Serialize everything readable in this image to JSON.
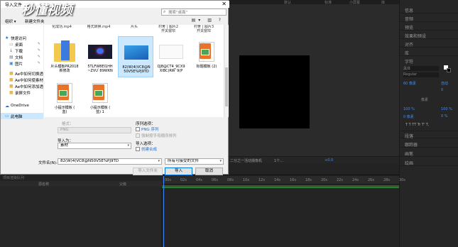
{
  "watermark": "秒懂视频",
  "dialog": {
    "title": "导入文件",
    "search_placeholder": "搜索\"桌面\"",
    "toolbar": {
      "organize": "组织 ▾",
      "new_folder": "新建文件夹"
    },
    "nav": [
      {
        "icon": "star-icon",
        "label": "快速访问",
        "pinned": false
      },
      {
        "icon": "desktop-folder-icon",
        "label": "桌面",
        "pinned": true
      },
      {
        "icon": "download-folder-icon",
        "label": "下载",
        "pinned": true
      },
      {
        "icon": "documents-folder-icon",
        "label": "文档",
        "pinned": true
      },
      {
        "icon": "pictures-folder-icon",
        "label": "图片",
        "pinned": true
      },
      {
        "icon": "folder-icon",
        "label": "Ae中如何切换透",
        "pinned": false
      },
      {
        "icon": "folder-icon",
        "label": "Ae中如何使素材",
        "pinned": false
      },
      {
        "icon": "folder-icon",
        "label": "Ae中如何添加透",
        "pinned": false
      },
      {
        "icon": "folder-icon",
        "label": "录屏文件",
        "pinned": false
      },
      {
        "icon": "onedrive-icon",
        "label": "OneDrive",
        "pinned": false
      },
      {
        "icon": "this-pc-icon",
        "label": "此电脑",
        "pinned": false,
        "selected": true
      }
    ],
    "top_partial_labels": [
      "",
      "化成功.mp4",
      "格式转换.mp4",
      "片头",
      "",
      "村舍 | 图片2\n开关窗帘",
      "村舍 | 图片3\n开关窗帘"
    ],
    "files": [
      {
        "name": "片头模板PR2018\n新修改",
        "kind": "folder"
      },
      {
        "name": "5TLFW8EI1HH\n~ZVU`89WKN",
        "kind": "image-dark"
      },
      {
        "name": "82(W)4(VC8@N\n50V5E%PJ9TD",
        "kind": "image-blue",
        "selected": true
      },
      {
        "name": "QJ8@CT4_9CX9\nXIBC(RW`9(P",
        "kind": "image-white"
      },
      {
        "name": "标题模板 (2)",
        "kind": "doc"
      },
      {
        "name": "小提示模板 (\n蓝)",
        "kind": "doc"
      },
      {
        "name": "小提示模板 (\n蓝) 1",
        "kind": "doc"
      }
    ],
    "format_label": "格式：",
    "format_value": "PNG",
    "import_as_label": "导入为：",
    "import_as_value": "素材",
    "sequence_options_label": "序列选项：",
    "png_sequence_label": "PNG 序列",
    "force_alpha_label": "强制按字母顺序排列",
    "import_options_label": "导入选项：",
    "create_composition_label": "创建合成",
    "filename_label": "文件名(N):",
    "filename_value": "82(W)4(VC8@N50V5E%PJ9TD",
    "filetype_value": "所有可接受的文件",
    "import_folder_button": "导入文件夹",
    "import_button": "导入",
    "cancel_button": "取消"
  },
  "ae": {
    "top_tabs": [
      "默认",
      "标准",
      "小屏幕",
      "库"
    ],
    "right_sections": [
      "信息",
      "音频",
      "预览",
      "效果和预设",
      "对齐",
      "库",
      "字符"
    ],
    "character": {
      "font": "黑体",
      "style": "Regular",
      "size": "60 像素",
      "leading": "自动",
      "tracking": "0",
      "units": "像素",
      "vscale": "100 %",
      "hscale": "100 %",
      "baseline": "0 像素",
      "tsume": "0 %",
      "format_row": "T T TT Tr T' T,"
    },
    "right_lower_sections": [
      "段落",
      "跟踪器",
      "画笔",
      "绘画"
    ],
    "viewer_bar": {
      "zoom": "二分之一",
      "camera": "活动摄像机",
      "views": "1个...",
      "offset": "+0.0"
    },
    "timeline": {
      "source_name_header": "源名称",
      "parent_header": "父级",
      "ruler_ticks": [
        "00s",
        "02s",
        "04s",
        "06s",
        "08s",
        "10s",
        "12s",
        "14s",
        "16s",
        "18s",
        "20s",
        "22s",
        "24s",
        "26s",
        "28s",
        "30s"
      ],
      "bottom_strip": "项目渲染队列"
    }
  },
  "colors": {
    "accent_blue": "#3d8dff",
    "selection_blue": "#cce8ff",
    "timeline_green": "#2e8b3a"
  }
}
